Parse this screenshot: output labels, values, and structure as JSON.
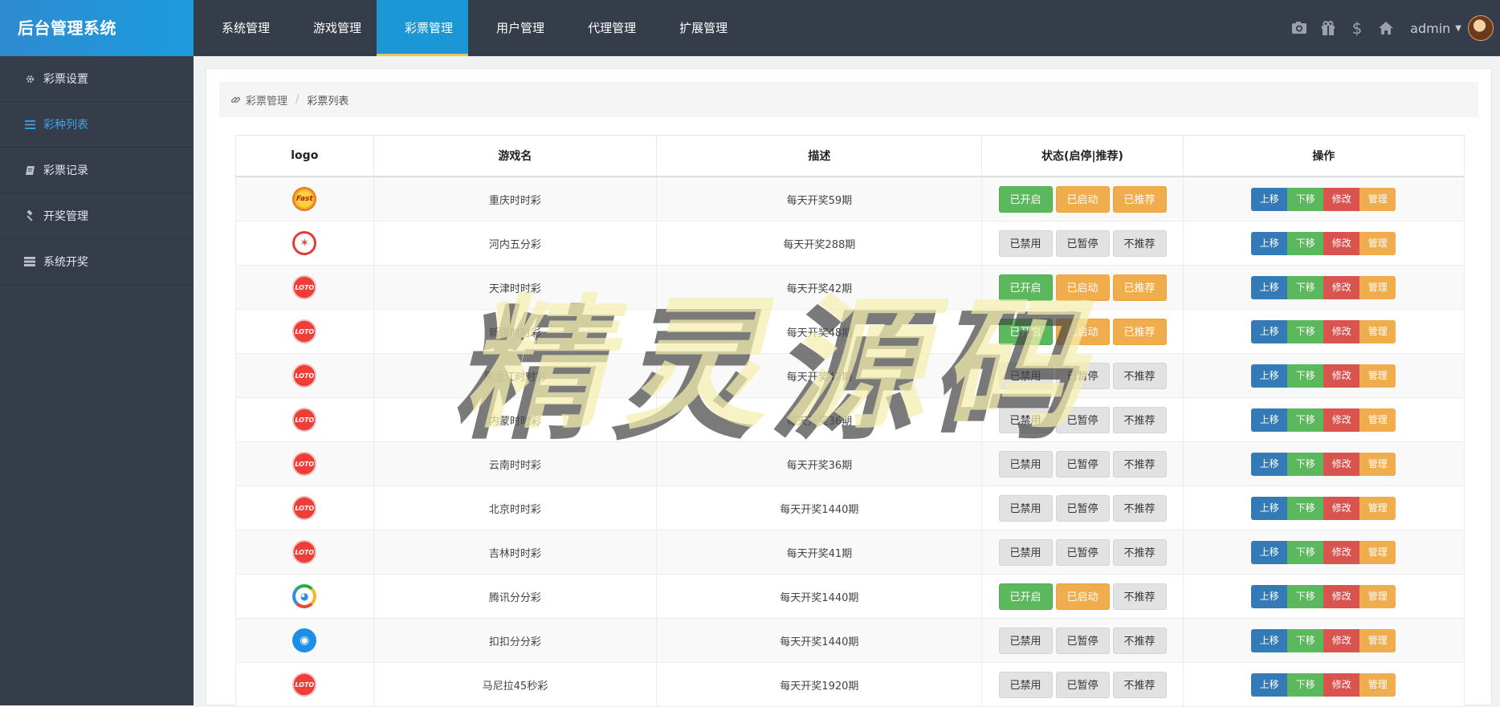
{
  "brand": "后台管理系统",
  "topnav": [
    "系统管理",
    "游戏管理",
    "彩票管理",
    "用户管理",
    "代理管理",
    "扩展管理"
  ],
  "topnav_active_index": 2,
  "topright": {
    "icons": [
      "camera-icon",
      "gift-icon",
      "dollar-icon",
      "home-icon"
    ],
    "user": "admin"
  },
  "sidebar": {
    "items": [
      {
        "label": "彩票设置",
        "icon": "gear-icon"
      },
      {
        "label": "彩种列表",
        "icon": "list-icon",
        "active": true
      },
      {
        "label": "彩票记录",
        "icon": "book-icon"
      },
      {
        "label": "开奖管理",
        "icon": "gavel-icon"
      },
      {
        "label": "系统开奖",
        "icon": "server-icon"
      }
    ]
  },
  "breadcrumb": {
    "parent": "彩票管理",
    "current": "彩票列表"
  },
  "table": {
    "headers": [
      "logo",
      "游戏名",
      "描述",
      "状态(启停|推荐)",
      "操作"
    ],
    "op_labels": [
      "上移",
      "下移",
      "修改",
      "管理"
    ],
    "rows": [
      {
        "logo": "cq",
        "name": "重庆时时彩",
        "desc": "每天开奖59期",
        "status": [
          "已开启",
          "已启动",
          "已推荐"
        ]
      },
      {
        "logo": "hn",
        "name": "河内五分彩",
        "desc": "每天开奖288期",
        "status": [
          "已禁用",
          "已暂停",
          "不推荐"
        ]
      },
      {
        "logo": "red",
        "name": "天津时时彩",
        "desc": "每天开奖42期",
        "status": [
          "已开启",
          "已启动",
          "已推荐"
        ]
      },
      {
        "logo": "red",
        "name": "新疆时时彩",
        "desc": "每天开奖48期",
        "status": [
          "已开启",
          "已启动",
          "已推荐"
        ]
      },
      {
        "logo": "red",
        "name": "黑龙江时时彩",
        "desc": "每天开奖42期",
        "status": [
          "已禁用",
          "已暂停",
          "不推荐"
        ]
      },
      {
        "logo": "red",
        "name": "内蒙时时彩",
        "desc": "每天开奖36期",
        "status": [
          "已禁用",
          "已暂停",
          "不推荐"
        ]
      },
      {
        "logo": "red",
        "name": "云南时时彩",
        "desc": "每天开奖36期",
        "status": [
          "已禁用",
          "已暂停",
          "不推荐"
        ]
      },
      {
        "logo": "red",
        "name": "北京时时彩",
        "desc": "每天开奖1440期",
        "status": [
          "已禁用",
          "已暂停",
          "不推荐"
        ]
      },
      {
        "logo": "red",
        "name": "吉林时时彩",
        "desc": "每天开奖41期",
        "status": [
          "已禁用",
          "已暂停",
          "不推荐"
        ]
      },
      {
        "logo": "tx",
        "name": "腾讯分分彩",
        "desc": "每天开奖1440期",
        "status": [
          "已开启",
          "已启动",
          "不推荐"
        ]
      },
      {
        "logo": "qq",
        "name": "扣扣分分彩",
        "desc": "每天开奖1440期",
        "status": [
          "已禁用",
          "已暂停",
          "不推荐"
        ]
      },
      {
        "logo": "red",
        "name": "马尼拉45秒彩",
        "desc": "每天开奖1920期",
        "status": [
          "已禁用",
          "已暂停",
          "不推荐"
        ]
      }
    ]
  },
  "colors": {
    "navbar": "#353c4a",
    "brand": "#1b9bde",
    "active_tab": "#1b97d6",
    "btn_green": "#5cb85c",
    "btn_orange": "#f0ad4e",
    "btn_gray": "#e2e2e2",
    "btn_blue": "#337ab7",
    "btn_red": "#d9534f"
  },
  "watermark": "精灵源码"
}
